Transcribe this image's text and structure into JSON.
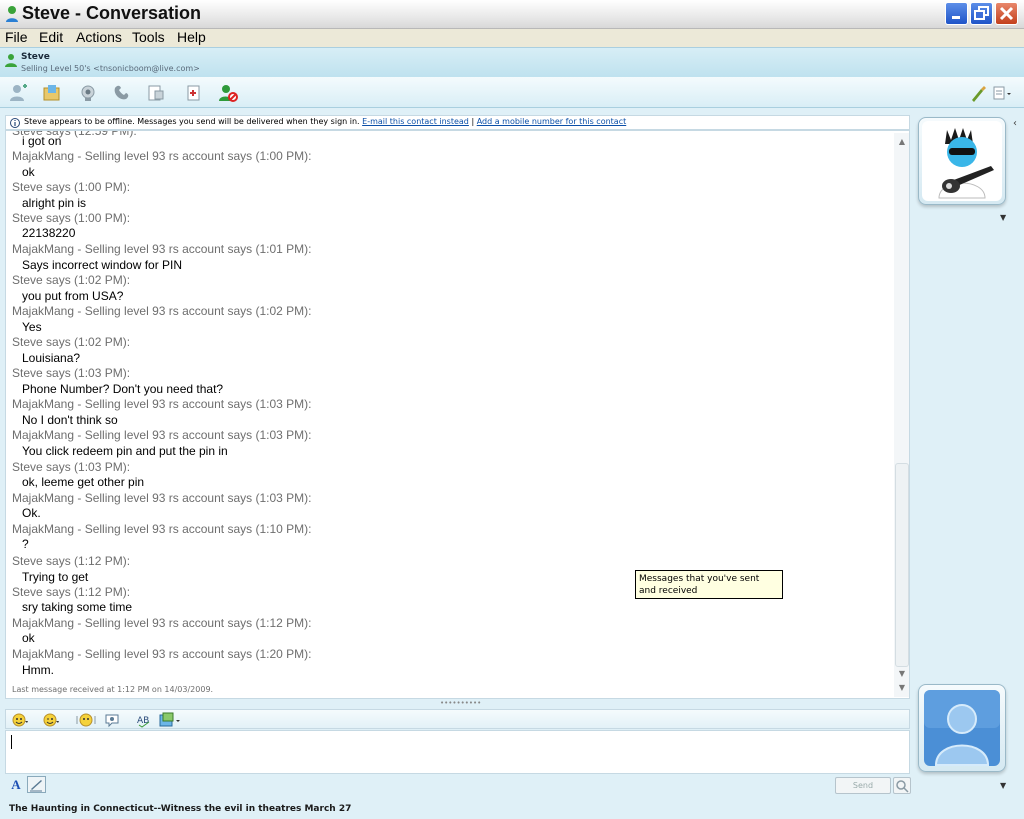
{
  "window": {
    "title": "Steve - Conversation"
  },
  "menu": [
    "File",
    "Edit",
    "Actions",
    "Tools",
    "Help"
  ],
  "contact": {
    "name": "Steve",
    "status": "Selling Level 50's <tnsonicboom@live.com>"
  },
  "toolbar": {
    "icons": [
      "invite-icon",
      "share-files-icon",
      "video-icon",
      "call-icon",
      "activities-icon",
      "games-icon",
      "block-icon",
      "paint-brush-icon",
      "options-menu-icon"
    ]
  },
  "info_bar": {
    "text": "Steve appears to be offline. Messages you send will be delivered when they sign in.",
    "email_link": "E-mail this contact instead",
    "separator": "|",
    "mobile_link": "Add a mobile number for this contact"
  },
  "conversation": {
    "messages": [
      {
        "body": "i got on"
      },
      {
        "header": "MajakMang - Selling level 93 rs account says (1:00 PM):",
        "body": "ok"
      },
      {
        "header": "Steve says (1:00 PM):",
        "body": "alright pin is"
      },
      {
        "header": "Steve says (1:00 PM):",
        "body": "22138220"
      },
      {
        "header": "MajakMang - Selling level 93 rs account says (1:01 PM):",
        "body": "Says incorrect window for PIN"
      },
      {
        "header": "Steve says (1:02 PM):",
        "body": "you put from USA?"
      },
      {
        "header": "MajakMang - Selling level 93 rs account says (1:02 PM):",
        "body": "Yes"
      },
      {
        "header": "Steve says (1:02 PM):",
        "body": "Louisiana?"
      },
      {
        "header": "Steve says (1:03 PM):",
        "body": "Phone Number? Don't you need that?"
      },
      {
        "header": "MajakMang - Selling level 93 rs account says (1:03 PM):",
        "body": "No I don't think so"
      },
      {
        "header": "MajakMang - Selling level 93 rs account says (1:03 PM):",
        "body": "You click redeem pin and put the pin in"
      },
      {
        "header": "Steve says (1:03 PM):",
        "body": "ok, leeme get other pin"
      },
      {
        "header": "MajakMang - Selling level 93 rs account says (1:03 PM):",
        "body": "Ok."
      },
      {
        "header": "MajakMang - Selling level 93 rs account says (1:10 PM):",
        "body": "?"
      },
      {
        "header": "Steve says (1:12 PM):",
        "body": "Trying to get"
      },
      {
        "header": "Steve says (1:12 PM):",
        "body": "sry taking some time"
      },
      {
        "header": "MajakMang - Selling level 93 rs account says (1:12 PM):",
        "body": "ok"
      },
      {
        "header": "MajakMang - Selling level 93 rs account says (1:20 PM):",
        "body": "Hmm."
      }
    ],
    "last_received": "Last message received at 1:12 PM on 14/03/2009."
  },
  "tooltip": "Messages that you've sent and received",
  "compose": {
    "value": "",
    "send_label": "Send",
    "font_label": "A"
  },
  "ad": {
    "text": "The Haunting in Connecticut--Witness the evil in theatres March 27"
  },
  "colors": {
    "header_text": "#6e6e6e",
    "link": "#0b4fa8",
    "accent": "#bfe2ef"
  }
}
